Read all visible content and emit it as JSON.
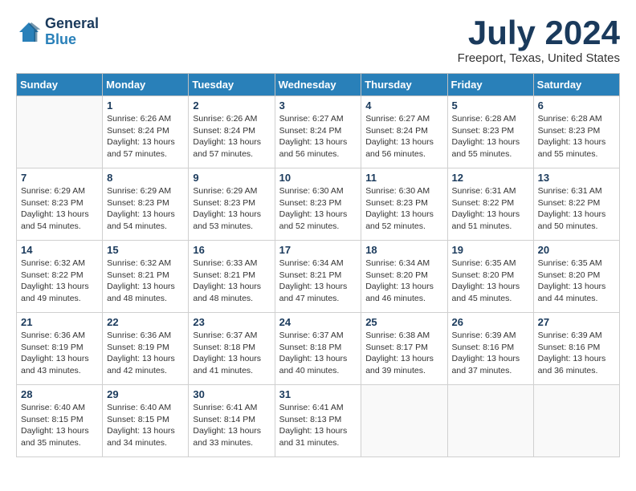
{
  "logo": {
    "line1": "General",
    "line2": "Blue"
  },
  "title": "July 2024",
  "location": "Freeport, Texas, United States",
  "weekdays": [
    "Sunday",
    "Monday",
    "Tuesday",
    "Wednesday",
    "Thursday",
    "Friday",
    "Saturday"
  ],
  "weeks": [
    [
      {
        "day": "",
        "sunrise": "",
        "sunset": "",
        "daylight": ""
      },
      {
        "day": "1",
        "sunrise": "Sunrise: 6:26 AM",
        "sunset": "Sunset: 8:24 PM",
        "daylight": "Daylight: 13 hours and 57 minutes."
      },
      {
        "day": "2",
        "sunrise": "Sunrise: 6:26 AM",
        "sunset": "Sunset: 8:24 PM",
        "daylight": "Daylight: 13 hours and 57 minutes."
      },
      {
        "day": "3",
        "sunrise": "Sunrise: 6:27 AM",
        "sunset": "Sunset: 8:24 PM",
        "daylight": "Daylight: 13 hours and 56 minutes."
      },
      {
        "day": "4",
        "sunrise": "Sunrise: 6:27 AM",
        "sunset": "Sunset: 8:24 PM",
        "daylight": "Daylight: 13 hours and 56 minutes."
      },
      {
        "day": "5",
        "sunrise": "Sunrise: 6:28 AM",
        "sunset": "Sunset: 8:23 PM",
        "daylight": "Daylight: 13 hours and 55 minutes."
      },
      {
        "day": "6",
        "sunrise": "Sunrise: 6:28 AM",
        "sunset": "Sunset: 8:23 PM",
        "daylight": "Daylight: 13 hours and 55 minutes."
      }
    ],
    [
      {
        "day": "7",
        "sunrise": "Sunrise: 6:29 AM",
        "sunset": "Sunset: 8:23 PM",
        "daylight": "Daylight: 13 hours and 54 minutes."
      },
      {
        "day": "8",
        "sunrise": "Sunrise: 6:29 AM",
        "sunset": "Sunset: 8:23 PM",
        "daylight": "Daylight: 13 hours and 54 minutes."
      },
      {
        "day": "9",
        "sunrise": "Sunrise: 6:29 AM",
        "sunset": "Sunset: 8:23 PM",
        "daylight": "Daylight: 13 hours and 53 minutes."
      },
      {
        "day": "10",
        "sunrise": "Sunrise: 6:30 AM",
        "sunset": "Sunset: 8:23 PM",
        "daylight": "Daylight: 13 hours and 52 minutes."
      },
      {
        "day": "11",
        "sunrise": "Sunrise: 6:30 AM",
        "sunset": "Sunset: 8:23 PM",
        "daylight": "Daylight: 13 hours and 52 minutes."
      },
      {
        "day": "12",
        "sunrise": "Sunrise: 6:31 AM",
        "sunset": "Sunset: 8:22 PM",
        "daylight": "Daylight: 13 hours and 51 minutes."
      },
      {
        "day": "13",
        "sunrise": "Sunrise: 6:31 AM",
        "sunset": "Sunset: 8:22 PM",
        "daylight": "Daylight: 13 hours and 50 minutes."
      }
    ],
    [
      {
        "day": "14",
        "sunrise": "Sunrise: 6:32 AM",
        "sunset": "Sunset: 8:22 PM",
        "daylight": "Daylight: 13 hours and 49 minutes."
      },
      {
        "day": "15",
        "sunrise": "Sunrise: 6:32 AM",
        "sunset": "Sunset: 8:21 PM",
        "daylight": "Daylight: 13 hours and 48 minutes."
      },
      {
        "day": "16",
        "sunrise": "Sunrise: 6:33 AM",
        "sunset": "Sunset: 8:21 PM",
        "daylight": "Daylight: 13 hours and 48 minutes."
      },
      {
        "day": "17",
        "sunrise": "Sunrise: 6:34 AM",
        "sunset": "Sunset: 8:21 PM",
        "daylight": "Daylight: 13 hours and 47 minutes."
      },
      {
        "day": "18",
        "sunrise": "Sunrise: 6:34 AM",
        "sunset": "Sunset: 8:20 PM",
        "daylight": "Daylight: 13 hours and 46 minutes."
      },
      {
        "day": "19",
        "sunrise": "Sunrise: 6:35 AM",
        "sunset": "Sunset: 8:20 PM",
        "daylight": "Daylight: 13 hours and 45 minutes."
      },
      {
        "day": "20",
        "sunrise": "Sunrise: 6:35 AM",
        "sunset": "Sunset: 8:20 PM",
        "daylight": "Daylight: 13 hours and 44 minutes."
      }
    ],
    [
      {
        "day": "21",
        "sunrise": "Sunrise: 6:36 AM",
        "sunset": "Sunset: 8:19 PM",
        "daylight": "Daylight: 13 hours and 43 minutes."
      },
      {
        "day": "22",
        "sunrise": "Sunrise: 6:36 AM",
        "sunset": "Sunset: 8:19 PM",
        "daylight": "Daylight: 13 hours and 42 minutes."
      },
      {
        "day": "23",
        "sunrise": "Sunrise: 6:37 AM",
        "sunset": "Sunset: 8:18 PM",
        "daylight": "Daylight: 13 hours and 41 minutes."
      },
      {
        "day": "24",
        "sunrise": "Sunrise: 6:37 AM",
        "sunset": "Sunset: 8:18 PM",
        "daylight": "Daylight: 13 hours and 40 minutes."
      },
      {
        "day": "25",
        "sunrise": "Sunrise: 6:38 AM",
        "sunset": "Sunset: 8:17 PM",
        "daylight": "Daylight: 13 hours and 39 minutes."
      },
      {
        "day": "26",
        "sunrise": "Sunrise: 6:39 AM",
        "sunset": "Sunset: 8:16 PM",
        "daylight": "Daylight: 13 hours and 37 minutes."
      },
      {
        "day": "27",
        "sunrise": "Sunrise: 6:39 AM",
        "sunset": "Sunset: 8:16 PM",
        "daylight": "Daylight: 13 hours and 36 minutes."
      }
    ],
    [
      {
        "day": "28",
        "sunrise": "Sunrise: 6:40 AM",
        "sunset": "Sunset: 8:15 PM",
        "daylight": "Daylight: 13 hours and 35 minutes."
      },
      {
        "day": "29",
        "sunrise": "Sunrise: 6:40 AM",
        "sunset": "Sunset: 8:15 PM",
        "daylight": "Daylight: 13 hours and 34 minutes."
      },
      {
        "day": "30",
        "sunrise": "Sunrise: 6:41 AM",
        "sunset": "Sunset: 8:14 PM",
        "daylight": "Daylight: 13 hours and 33 minutes."
      },
      {
        "day": "31",
        "sunrise": "Sunrise: 6:41 AM",
        "sunset": "Sunset: 8:13 PM",
        "daylight": "Daylight: 13 hours and 31 minutes."
      },
      {
        "day": "",
        "sunrise": "",
        "sunset": "",
        "daylight": ""
      },
      {
        "day": "",
        "sunrise": "",
        "sunset": "",
        "daylight": ""
      },
      {
        "day": "",
        "sunrise": "",
        "sunset": "",
        "daylight": ""
      }
    ]
  ]
}
